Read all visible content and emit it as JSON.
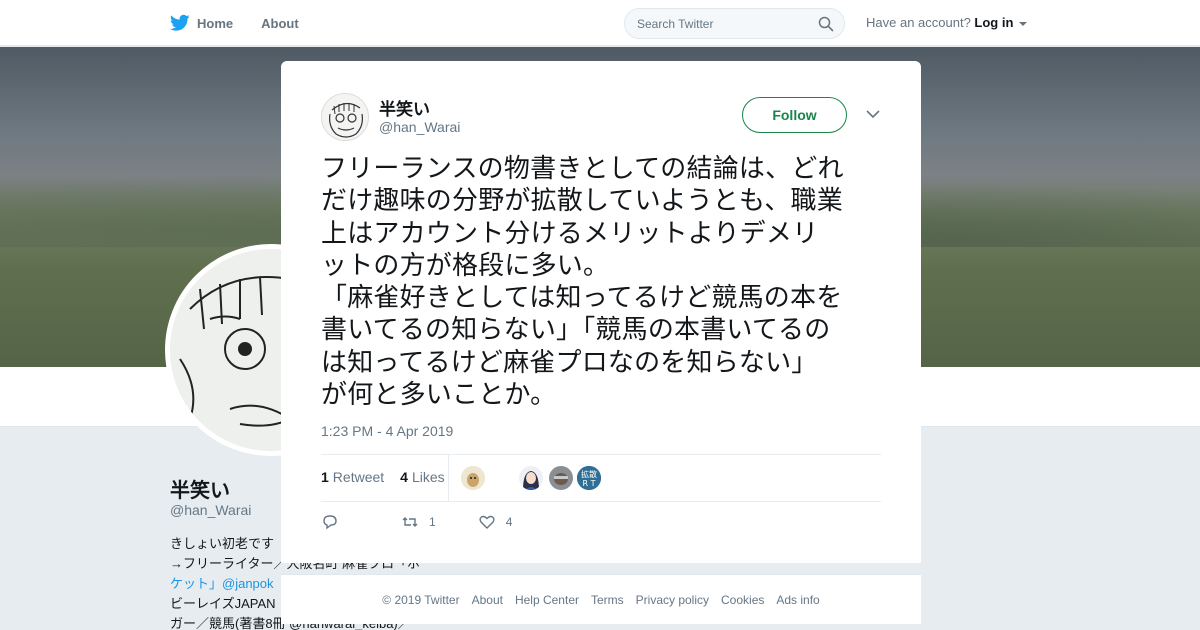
{
  "nav": {
    "home_label": "Home",
    "about_label": "About",
    "search_placeholder": "Search Twitter",
    "account_prompt": "Have an account?",
    "login_label": "Log in"
  },
  "profile_bg": {
    "name": "半笑い",
    "handle": "@han_Warai",
    "bio_lines": [
      "きしょい初老です",
      "→フリーライター／大阪名町 麻雀プロ「ポ",
      "ケット」@janpok",
      "ビーレイズJAPAN",
      "ガー／競馬(著書8冊 @hanwarai_keiba)／"
    ]
  },
  "tweet": {
    "author_name": "半笑い",
    "author_handle": "@han_Warai",
    "follow_label": "Follow",
    "text_lines": [
      "フリーランスの物書きとしての結論は、どれ",
      "だけ趣味の分野が拡散していようとも、職業",
      "上はアカウント分けるメリットよりデメリ",
      "ットの方が格段に多い。",
      "「麻雀好きとしては知ってるけど競馬の本を",
      "書いてるの知らない」「競馬の本書いてるの",
      "は知ってるけど麻雀プロなのを知らない」",
      "が何と多いことか。"
    ],
    "timestamp": "1:23 PM - 4 Apr 2019",
    "retweets_count": "1",
    "retweets_label": "Retweet",
    "likes_count": "4",
    "likes_label": "Likes",
    "action_retweet_count": "1",
    "action_like_count": "4",
    "liker_badge_text": "拡散R T"
  },
  "footer": {
    "copyright": "© 2019 Twitter",
    "about": "About",
    "help": "Help Center",
    "terms": "Terms",
    "privacy": "Privacy policy",
    "cookies": "Cookies",
    "ads": "Ads info"
  },
  "colors": {
    "brand": "#1da1f2",
    "follow": "#19854a",
    "muted": "#657786",
    "link": "#1b95e0"
  }
}
